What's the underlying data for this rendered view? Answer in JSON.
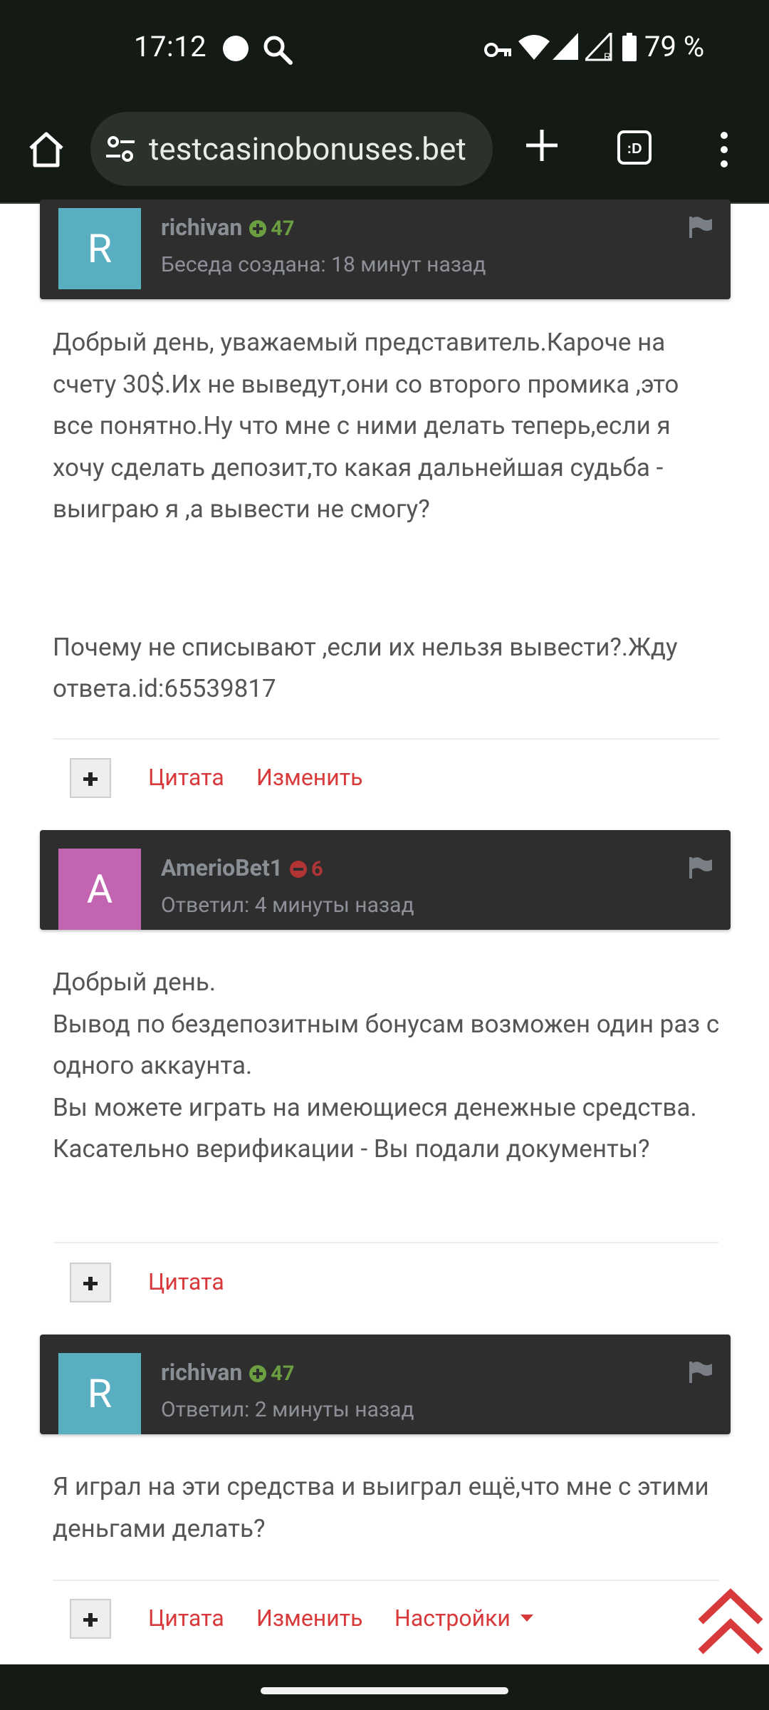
{
  "status_bar": {
    "time": "17:12",
    "battery": "79 %",
    "icons": [
      "dot-icon",
      "search-icon",
      "key-icon",
      "wifi-icon",
      "signal-icon",
      "signal-roaming-icon",
      "battery-icon"
    ]
  },
  "browser": {
    "url": "testcasinobonuses.bet",
    "icons": [
      "home-icon",
      "site-settings-icon",
      "new-tab-icon",
      "tab-switcher-icon",
      "menu-icon"
    ]
  },
  "posts": [
    {
      "avatar_letter": "R",
      "avatar_color": "#5aaec2",
      "author": "richivan",
      "reputation": "47",
      "reputation_type": "positive",
      "meta": "Беседа создана: 18 минут назад",
      "paragraphs": [
        "Добрый день, уважаемый представитель.Кароче на счету 30$.Их не выведут,они со второго промика ,это все понятно.Ну что мне с ними делать теперь,если я хочу сделать депозит,то какая дальнейшая судьба - выиграю я ,а вывести не смогу?",
        "Почему не списывают ,если их нельзя вывести?.Жду ответа.id:65539817"
      ],
      "actions": [
        "Цитата",
        "Изменить"
      ]
    },
    {
      "avatar_letter": "A",
      "avatar_color": "#c264b2",
      "author": "AmerioBet1",
      "reputation": "6",
      "reputation_type": "negative",
      "meta": "Ответил: 4 минуты назад",
      "paragraphs": [
        "Добрый день.",
        "Вывод по бездепозитным бонусам возможен один раз с одного аккаунта.",
        "Вы можете играть на имеющиеся денежные средства.",
        "Касательно верификации - Вы подали документы?"
      ],
      "actions": [
        "Цитата"
      ]
    },
    {
      "avatar_letter": "R",
      "avatar_color": "#5aaec2",
      "author": "richivan",
      "reputation": "47",
      "reputation_type": "positive",
      "meta": "Ответил: 2 минуты назад",
      "paragraphs": [
        "Я играл на эти средства и выиграл ещё,что мне с этими деньгами делать?"
      ],
      "actions": [
        "Цитата",
        "Изменить",
        "Настройки"
      ]
    }
  ],
  "colors": {
    "link": "#d8393b",
    "header_bg": "#2e2e2e",
    "rep_positive": "#6a9e40",
    "rep_negative": "#b33434"
  }
}
